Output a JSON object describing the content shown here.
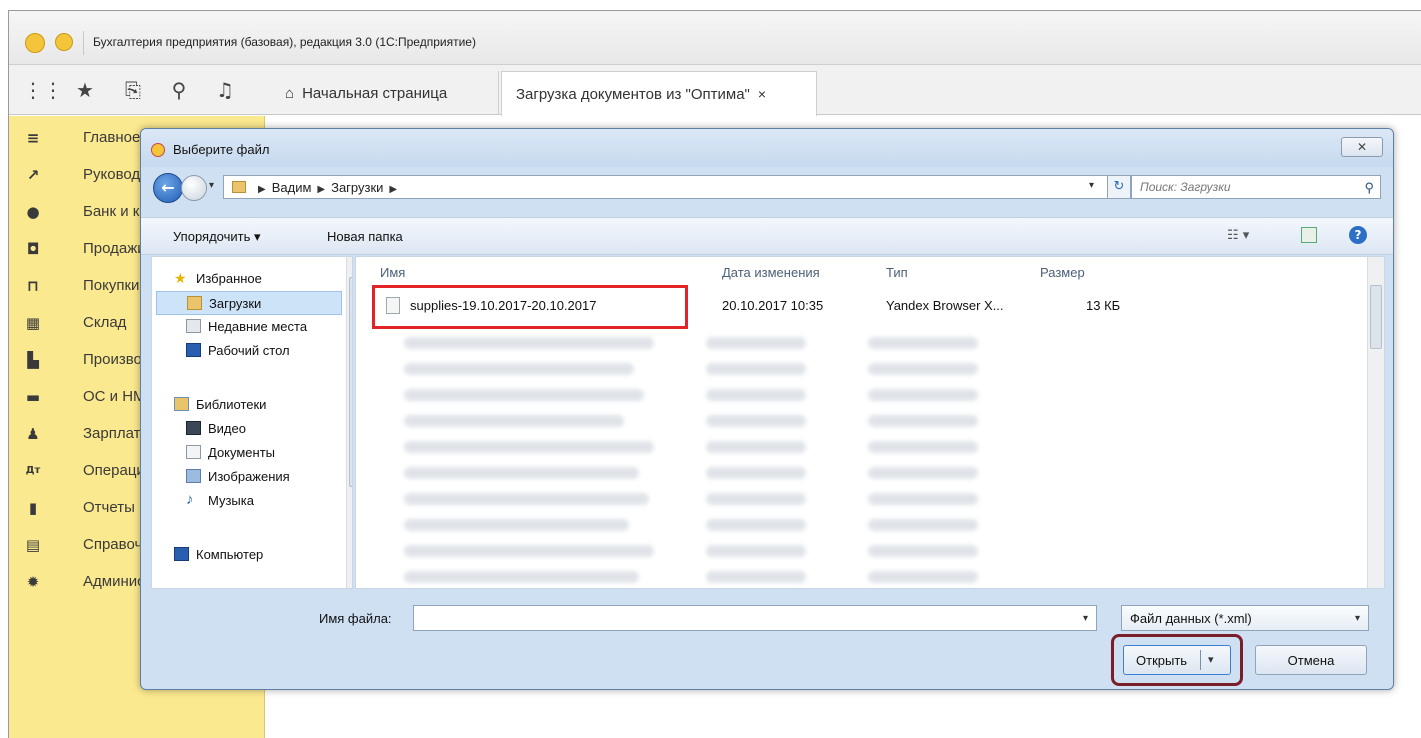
{
  "window": {
    "title": "Бухгалтерия предприятия (базовая), редакция 3.0  (1С:Предприятие)"
  },
  "toolbar": {
    "icons": [
      "apps-grid-icon",
      "star-icon",
      "history-icon",
      "search-icon",
      "bell-icon"
    ],
    "tabs": [
      {
        "label": "Начальная страница",
        "icon": "home-icon",
        "active": false
      },
      {
        "label": "Загрузка документов из \"Оптима\"",
        "active": true,
        "close": "×"
      }
    ]
  },
  "sidebar": {
    "items": [
      {
        "label": "Главное",
        "icon": "menu-icon"
      },
      {
        "label": "Руководителю",
        "icon": "chart-line-icon"
      },
      {
        "label": "Банк и касса",
        "icon": "bank-icon"
      },
      {
        "label": "Продажи",
        "icon": "bag-icon"
      },
      {
        "label": "Покупки",
        "icon": "cart-icon"
      },
      {
        "label": "Склад",
        "icon": "warehouse-icon"
      },
      {
        "label": "Производство",
        "icon": "factory-icon"
      },
      {
        "label": "ОС и НМА",
        "icon": "truck-icon"
      },
      {
        "label": "Зарплата и кадры",
        "icon": "person-icon"
      },
      {
        "label": "Операции",
        "icon": "dt-kt-icon"
      },
      {
        "label": "Отчеты",
        "icon": "bar-chart-icon"
      },
      {
        "label": "Справочники",
        "icon": "book-icon"
      },
      {
        "label": "Администрирование",
        "icon": "gear-icon"
      }
    ]
  },
  "dialog": {
    "title": "Выберите файл",
    "close_label": "✕",
    "address": {
      "path": [
        "Вадим",
        "Загрузки"
      ],
      "search_placeholder": "Поиск: Загрузки"
    },
    "commands": {
      "organize": "Упорядочить ▾",
      "new_folder": "Новая папка"
    },
    "nav": {
      "items": [
        {
          "label": "Избранное",
          "icon": "star-icon",
          "level": 0
        },
        {
          "label": "Загрузки",
          "icon": "folder-icon",
          "level": 1,
          "selected": true
        },
        {
          "label": "Недавние места",
          "icon": "recent-places-icon",
          "level": 1
        },
        {
          "label": "Рабочий стол",
          "icon": "desktop-icon",
          "level": 1
        },
        {
          "label": "Библиотеки",
          "icon": "library-icon",
          "level": 0
        },
        {
          "label": "Видео",
          "icon": "video-icon",
          "level": 1
        },
        {
          "label": "Документы",
          "icon": "document-icon",
          "level": 1
        },
        {
          "label": "Изображения",
          "icon": "image-icon",
          "level": 1
        },
        {
          "label": "Музыка",
          "icon": "music-icon",
          "level": 1
        },
        {
          "label": "Компьютер",
          "icon": "computer-icon",
          "level": 0
        }
      ]
    },
    "columns": {
      "name": "Имя",
      "date": "Дата изменения",
      "type": "Тип",
      "size": "Размер"
    },
    "file": {
      "name": "supplies-19.10.2017-20.10.2017",
      "date": "20.10.2017 10:35",
      "type": "Yandex Browser X...",
      "size": "13 КБ"
    },
    "filename_label": "Имя файла:",
    "filename_value": "",
    "filter": "Файл данных (*.xml)",
    "open_label": "Открыть",
    "cancel_label": "Отмена"
  },
  "colors": {
    "sidebar_bg": "#fbe98f",
    "highlight_red": "#e32326",
    "highlight_dark_red": "#7a1f2a",
    "dialog_frame": "#cfe0f3"
  }
}
